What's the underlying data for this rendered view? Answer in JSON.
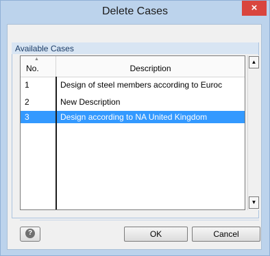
{
  "window": {
    "title": "Delete Cases",
    "close_symbol": "×"
  },
  "group": {
    "label": "Available Cases"
  },
  "table": {
    "columns": [
      "No.",
      "Description"
    ],
    "sort_indicator": "▲",
    "rows": [
      {
        "no": "1",
        "description": "Design of steel members according to Euroc"
      },
      {
        "no": "2",
        "description": "New Description"
      },
      {
        "no": "3",
        "description": "Design according to NA United Kingdom"
      }
    ],
    "selected_row": 3
  },
  "scrollbar": {
    "up_symbol": "▲",
    "down_symbol": "▼"
  },
  "buttons": {
    "help_symbol": "?",
    "ok_label": "OK",
    "cancel_label": "Cancel"
  },
  "colors": {
    "selection": "#3399ff",
    "close_button": "#d9453e",
    "dialog_frame": "#bcd3ec"
  },
  "icons": {
    "help": "question-circle-icon",
    "close": "close-icon",
    "scroll_up": "scroll-up-arrow-icon",
    "scroll_down": "scroll-down-arrow-icon",
    "sort": "sort-ascending-icon"
  }
}
